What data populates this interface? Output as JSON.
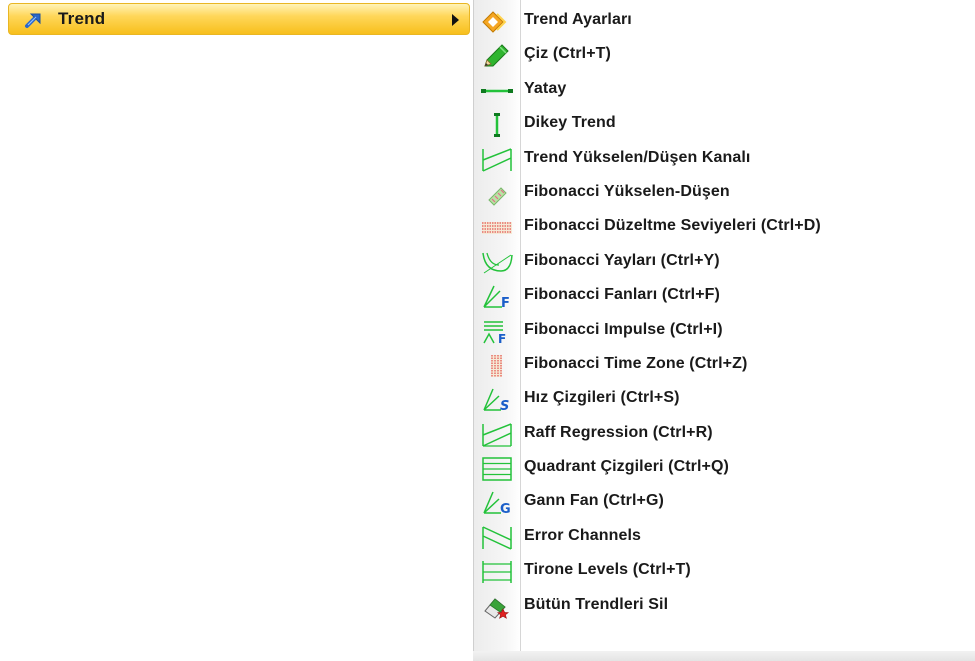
{
  "parent_menu": {
    "label": "Trend",
    "icon": "arrow-up-right-icon"
  },
  "submenu": {
    "items": [
      {
        "label": "Trend Ayarları",
        "icon": "trend-settings-icon"
      },
      {
        "label": "Çiz (Ctrl+T)",
        "icon": "pencil-icon"
      },
      {
        "label": "Yatay",
        "icon": "horizontal-line-icon"
      },
      {
        "label": "Dikey Trend",
        "icon": "vertical-line-icon"
      },
      {
        "label": "Trend Yükselen/Düşen Kanalı",
        "icon": "channel-icon"
      },
      {
        "label": "Fibonacci Yükselen-Düşen",
        "icon": "fibonacci-ruler-icon"
      },
      {
        "label": "Fibonacci Düzeltme Seviyeleri (Ctrl+D)",
        "icon": "fibonacci-retracement-icon"
      },
      {
        "label": "Fibonacci Yayları (Ctrl+Y)",
        "icon": "fibonacci-arcs-icon"
      },
      {
        "label": "Fibonacci Fanları (Ctrl+F)",
        "icon": "fibonacci-fan-icon"
      },
      {
        "label": "Fibonacci Impulse (Ctrl+I)",
        "icon": "fibonacci-impulse-icon"
      },
      {
        "label": "Fibonacci Time Zone (Ctrl+Z)",
        "icon": "fibonacci-time-zone-icon"
      },
      {
        "label": "Hız Çizgileri (Ctrl+S)",
        "icon": "speed-lines-icon"
      },
      {
        "label": "Raff Regression (Ctrl+R)",
        "icon": "raff-regression-icon"
      },
      {
        "label": "Quadrant Çizgileri (Ctrl+Q)",
        "icon": "quadrant-lines-icon"
      },
      {
        "label": "Gann Fan (Ctrl+G)",
        "icon": "gann-fan-icon"
      },
      {
        "label": "Error Channels",
        "icon": "error-channels-icon"
      },
      {
        "label": "Tirone Levels (Ctrl+T)",
        "icon": "tirone-levels-icon"
      },
      {
        "label": "Bütün Trendleri Sil",
        "icon": "eraser-delete-icon"
      }
    ]
  },
  "colors": {
    "highlight": "#f7bf1c",
    "icon_green": "#23c23a",
    "icon_blue": "#1a5ec9",
    "icon_red": "#e02020"
  }
}
